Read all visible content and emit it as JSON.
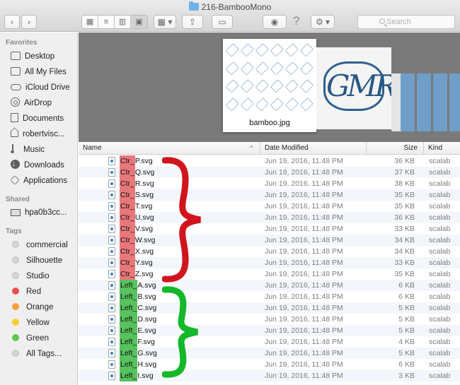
{
  "window": {
    "title": "216-BambooMono",
    "search_placeholder": "Search"
  },
  "sidebar": {
    "favorites_heading": "Favorites",
    "favorites": [
      {
        "label": "Desktop",
        "icon": "desktop-icon"
      },
      {
        "label": "All My Files",
        "icon": "all-files-icon"
      },
      {
        "label": "iCloud Drive",
        "icon": "cloud-icon"
      },
      {
        "label": "AirDrop",
        "icon": "airdrop-icon"
      },
      {
        "label": "Documents",
        "icon": "document-icon"
      },
      {
        "label": "robertvisc...",
        "icon": "home-icon"
      },
      {
        "label": "Music",
        "icon": "music-icon"
      },
      {
        "label": "Downloads",
        "icon": "downloads-icon"
      },
      {
        "label": "Applications",
        "icon": "applications-icon"
      }
    ],
    "shared_heading": "Shared",
    "shared": [
      {
        "label": "hpa0b3cc...",
        "icon": "computer-icon"
      }
    ],
    "tags_heading": "Tags",
    "tags": [
      {
        "label": "commercial",
        "color": ""
      },
      {
        "label": "Silhouette",
        "color": ""
      },
      {
        "label": "Studio",
        "color": ""
      },
      {
        "label": "Red",
        "color": "#f0504e"
      },
      {
        "label": "Orange",
        "color": "#f6a13b"
      },
      {
        "label": "Yellow",
        "color": "#f5cf2d"
      },
      {
        "label": "Green",
        "color": "#5ec750"
      },
      {
        "label": "All Tags...",
        "color": ""
      }
    ]
  },
  "preview": {
    "caption": "bamboo.jpg",
    "monogram_text": "GMR"
  },
  "columns": {
    "name": "Name",
    "date": "Date Modified",
    "size": "Size",
    "kind": "Kind"
  },
  "files": [
    {
      "prefix": "Ctr_",
      "rest": "P.svg",
      "date": "Jun 19, 2016, 11:48 PM",
      "size": "36 KB",
      "kind": "scalab",
      "group": "red"
    },
    {
      "prefix": "Ctr_",
      "rest": "Q.svg",
      "date": "Jun 19, 2016, 11:48 PM",
      "size": "37 KB",
      "kind": "scalab",
      "group": "red"
    },
    {
      "prefix": "Ctr_",
      "rest": "R.svg",
      "date": "Jun 19, 2016, 11:48 PM",
      "size": "38 KB",
      "kind": "scalab",
      "group": "red"
    },
    {
      "prefix": "Ctr_",
      "rest": "S.svg",
      "date": "Jun 19, 2016, 11:48 PM",
      "size": "35 KB",
      "kind": "scalab",
      "group": "red"
    },
    {
      "prefix": "Ctr_",
      "rest": "T.svg",
      "date": "Jun 19, 2016, 11:48 PM",
      "size": "35 KB",
      "kind": "scalab",
      "group": "red"
    },
    {
      "prefix": "Ctr_",
      "rest": "U.svg",
      "date": "Jun 19, 2016, 11:48 PM",
      "size": "36 KB",
      "kind": "scalab",
      "group": "red"
    },
    {
      "prefix": "Ctr_",
      "rest": "V.svg",
      "date": "Jun 19, 2016, 11:48 PM",
      "size": "33 KB",
      "kind": "scalab",
      "group": "red"
    },
    {
      "prefix": "Ctr_",
      "rest": "W.svg",
      "date": "Jun 19, 2016, 11:48 PM",
      "size": "34 KB",
      "kind": "scalab",
      "group": "red"
    },
    {
      "prefix": "Ctr_",
      "rest": "X.svg",
      "date": "Jun 19, 2016, 11:48 PM",
      "size": "34 KB",
      "kind": "scalab",
      "group": "red"
    },
    {
      "prefix": "Ctr_",
      "rest": "Y.svg",
      "date": "Jun 19, 2016, 11:48 PM",
      "size": "33 KB",
      "kind": "scalab",
      "group": "red"
    },
    {
      "prefix": "Ctr_",
      "rest": "Z.svg",
      "date": "Jun 19, 2016, 11:48 PM",
      "size": "35 KB",
      "kind": "scalab",
      "group": "red"
    },
    {
      "prefix": "Left_",
      "rest": "A.svg",
      "date": "Jun 19, 2016, 11:48 PM",
      "size": "6 KB",
      "kind": "scalab",
      "group": "green"
    },
    {
      "prefix": "Left_",
      "rest": "B.svg",
      "date": "Jun 19, 2016, 11:48 PM",
      "size": "6 KB",
      "kind": "scalab",
      "group": "green"
    },
    {
      "prefix": "Left_",
      "rest": "C.svg",
      "date": "Jun 19, 2016, 11:48 PM",
      "size": "5 KB",
      "kind": "scalab",
      "group": "green"
    },
    {
      "prefix": "Left_",
      "rest": "D.svg",
      "date": "Jun 19, 2016, 11:48 PM",
      "size": "5 KB",
      "kind": "scalab",
      "group": "green"
    },
    {
      "prefix": "Left_",
      "rest": "E.svg",
      "date": "Jun 19, 2016, 11:48 PM",
      "size": "5 KB",
      "kind": "scalab",
      "group": "green"
    },
    {
      "prefix": "Left_",
      "rest": "F.svg",
      "date": "Jun 19, 2016, 11:48 PM",
      "size": "4 KB",
      "kind": "scalab",
      "group": "green"
    },
    {
      "prefix": "Left_",
      "rest": "G.svg",
      "date": "Jun 19, 2016, 11:48 PM",
      "size": "5 KB",
      "kind": "scalab",
      "group": "green"
    },
    {
      "prefix": "Left_",
      "rest": "H.svg",
      "date": "Jun 19, 2016, 11:48 PM",
      "size": "6 KB",
      "kind": "scalab",
      "group": "green"
    },
    {
      "prefix": "Left_",
      "rest": "I.svg",
      "date": "Jun 19, 2016, 11:48 PM",
      "size": "3 KB",
      "kind": "scalab",
      "group": "green"
    }
  ],
  "colors": {
    "ctr_highlight": "#e8787a",
    "left_highlight": "#57c25e",
    "red_brace": "#d0151e",
    "green_brace": "#14b82a"
  }
}
